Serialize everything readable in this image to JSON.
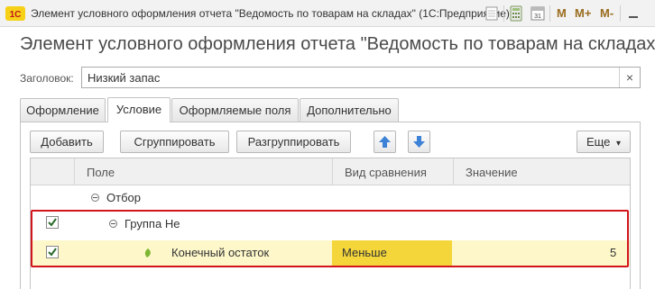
{
  "window": {
    "title": "Элемент условного оформления отчета \"Ведомость по товарам на складах\" (1С:Предприятие)",
    "logo_text": "1С",
    "toolbar": {
      "m_label": "M",
      "m_plus_label": "M+",
      "m_minus_label": "M-",
      "calendar_day": "31"
    }
  },
  "header": {
    "title": "Элемент условного оформления отчета \"Ведомость по товарам на складах\""
  },
  "form": {
    "zagolovok_label": "Заголовок:",
    "zagolovok_value": "Низкий запас",
    "clear_label": "×"
  },
  "tabs": [
    {
      "label": "Оформление",
      "active": false
    },
    {
      "label": "Условие",
      "active": true
    },
    {
      "label": "Оформляемые поля",
      "active": false
    },
    {
      "label": "Дополнительно",
      "active": false
    }
  ],
  "toolbar": {
    "add": "Добавить",
    "group": "Сгруппировать",
    "ungroup": "Разгруппировать",
    "more": "Еще",
    "more_arrow": "▾"
  },
  "grid": {
    "columns": [
      "Поле",
      "Вид сравнения",
      "Значение"
    ],
    "rows": [
      {
        "field": "Отбор",
        "checked": null,
        "comparison": "",
        "value": ""
      },
      {
        "field": "Группа Не",
        "checked": true,
        "comparison": "",
        "value": ""
      },
      {
        "field": "Конечный остаток",
        "checked": true,
        "comparison": "Меньше",
        "value": "5"
      }
    ]
  },
  "colors": {
    "highlight_row": "#fdf7c9",
    "highlight_cell": "#f4d63a",
    "red_frame": "#d2141b",
    "arrow_blue": "#3d82d6"
  }
}
